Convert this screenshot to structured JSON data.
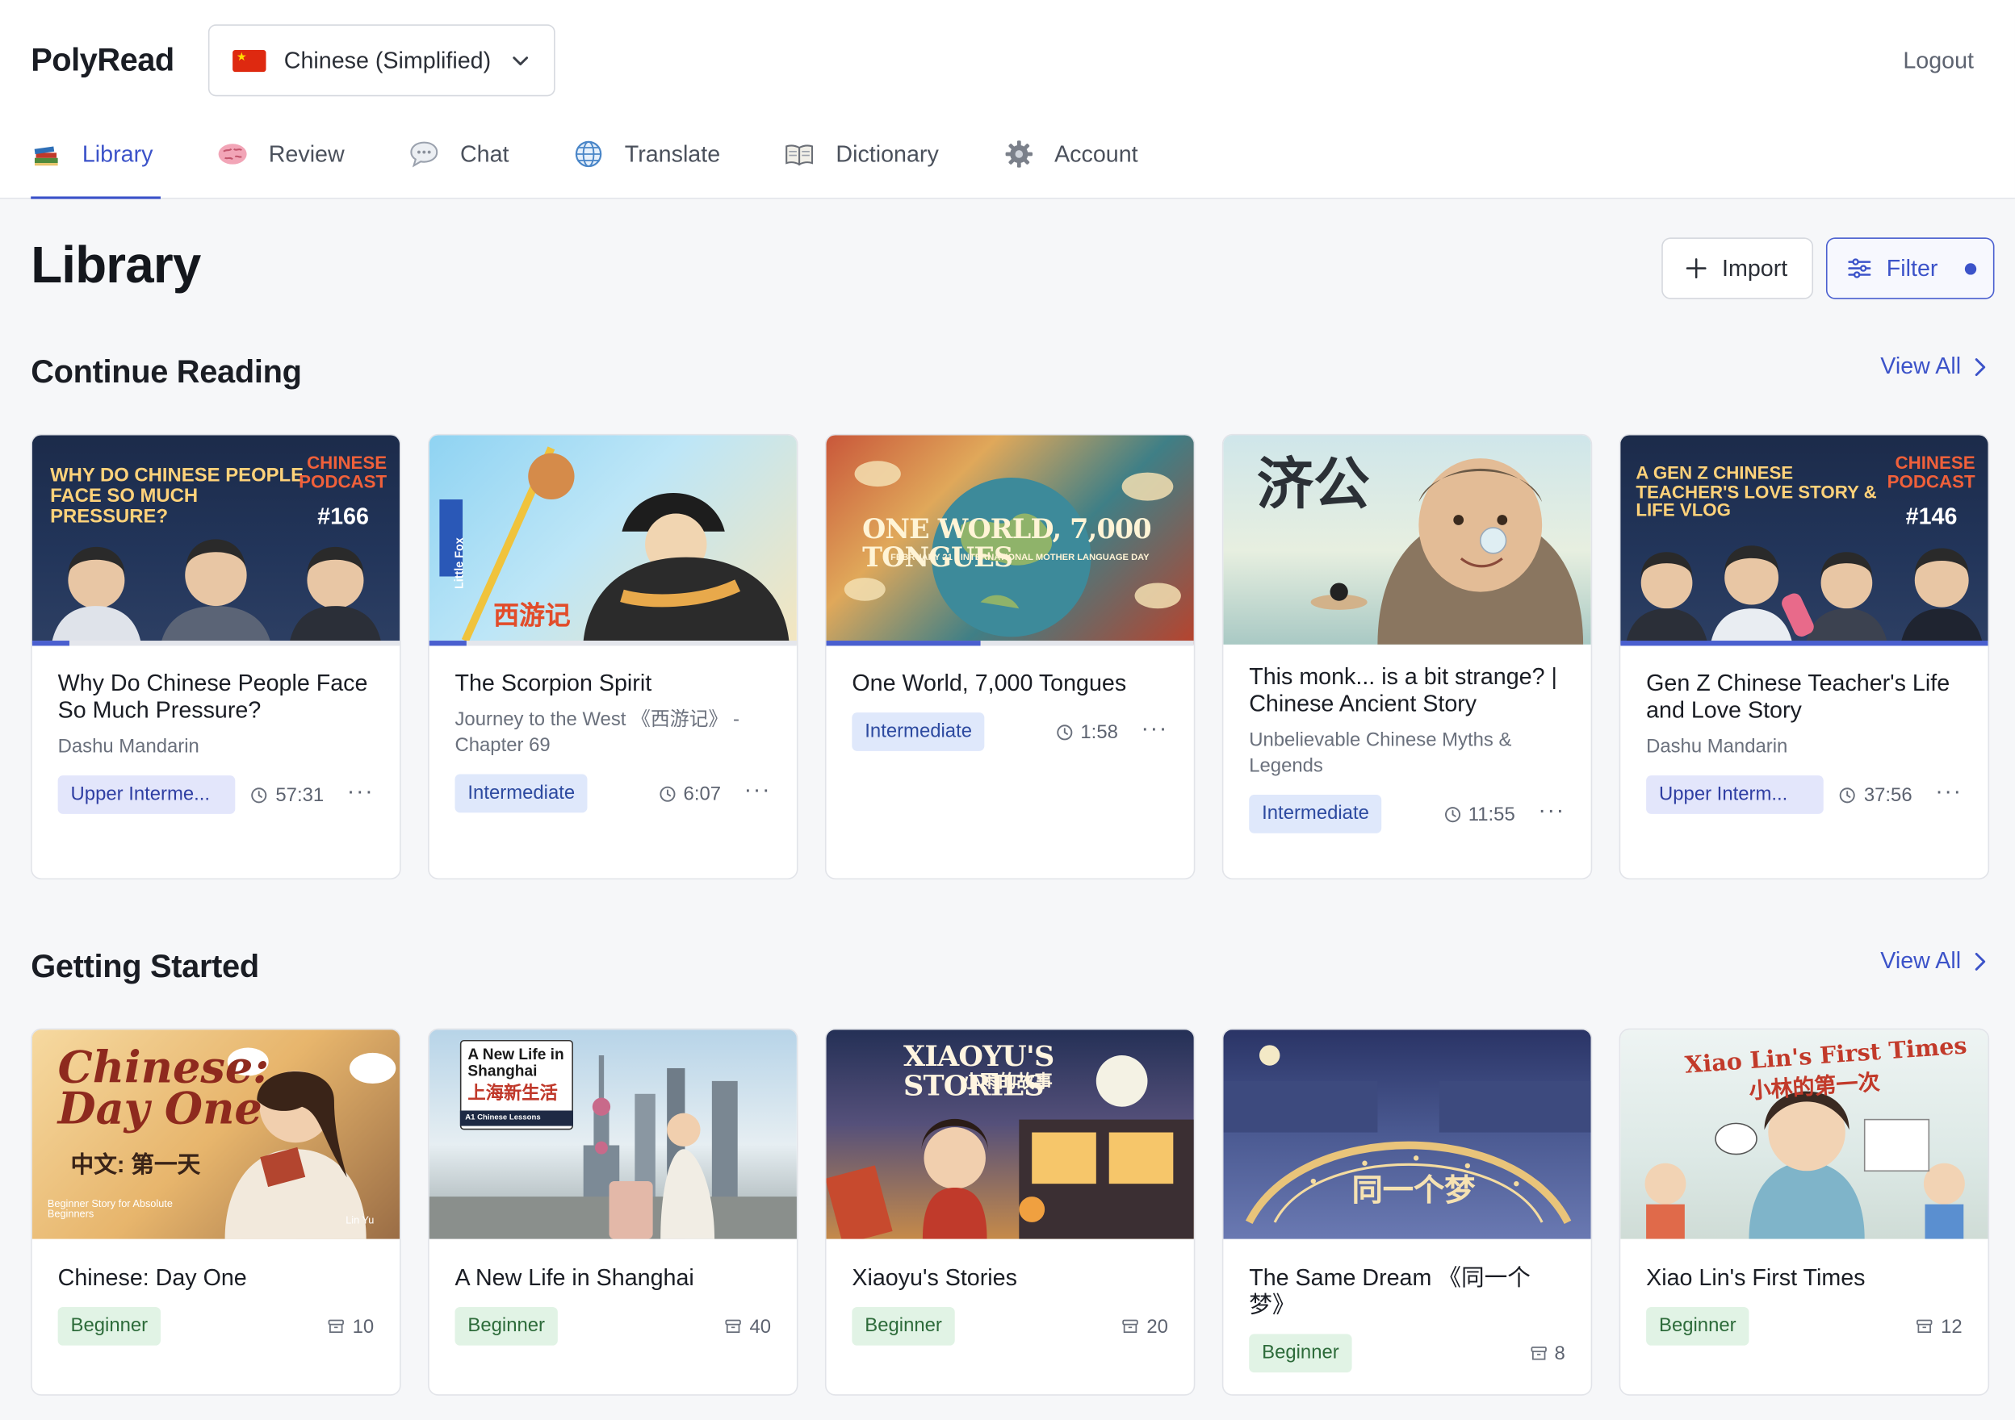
{
  "app": {
    "name": "PolyRead",
    "language": "Chinese (Simplified)",
    "logout_label": "Logout"
  },
  "nav": [
    {
      "label": "Library",
      "icon": "books-icon"
    },
    {
      "label": "Review",
      "icon": "brain-icon"
    },
    {
      "label": "Chat",
      "icon": "speech-bubble-icon"
    },
    {
      "label": "Translate",
      "icon": "globe-icon"
    },
    {
      "label": "Dictionary",
      "icon": "open-book-icon"
    },
    {
      "label": "Account",
      "icon": "gear-icon"
    }
  ],
  "page": {
    "title": "Library",
    "import_label": "Import",
    "filter_label": "Filter"
  },
  "continue_reading": {
    "title": "Continue Reading",
    "view_all": "View All",
    "items": [
      {
        "title": "Why Do Chinese People Face So Much Pressure?",
        "source": "Dashu Mandarin",
        "level": "Upper Interme...",
        "duration": "57:31",
        "progress": 0.1,
        "thumb_title": "Why do Chinese people face so much pressure?",
        "thumb_tag": "Chinese Podcast",
        "thumb_number": "#166"
      },
      {
        "title": "The Scorpion Spirit",
        "source": "Journey to the West 《西游记》 - Chapter 69",
        "level": "Intermediate",
        "duration": "6:07",
        "progress": 0.1,
        "thumb_title": "西游记",
        "thumb_side": "Little Fox"
      },
      {
        "title": "One World, 7,000 Tongues",
        "level": "Intermediate",
        "duration": "1:58",
        "progress": 0.42,
        "thumb_title": "One World, 7,000 Tongues",
        "thumb_sub": "February 21 · International Mother Language Day"
      },
      {
        "title": "This monk... is a bit strange? | Chinese Ancient Story",
        "source": "Unbelievable Chinese Myths & Legends",
        "level": "Intermediate",
        "duration": "11:55",
        "progress": 0.0,
        "thumb_title": "济公"
      },
      {
        "title": "Gen Z Chinese Teacher's Life and Love Story",
        "source": "Dashu Mandarin",
        "level": "Upper Interm...",
        "duration": "37:56",
        "progress": 1.0,
        "thumb_title": "A Gen Z Chinese teacher's love story & life vlog",
        "thumb_tag": "Chinese Podcast",
        "thumb_number": "#146"
      }
    ]
  },
  "getting_started": {
    "title": "Getting Started",
    "view_all": "View All",
    "items": [
      {
        "title": "Chinese: Day One",
        "level": "Beginner",
        "count": "10",
        "thumb_title": "Chinese: Day One",
        "thumb_sub": "中文: 第一天",
        "thumb_note": "Beginner Story for Absolute Beginners",
        "thumb_author": "Lin Yu"
      },
      {
        "title": "A New Life in Shanghai",
        "level": "Beginner",
        "count": "40",
        "thumb_title": "A New Life in Shanghai",
        "thumb_sub": "上海新生活",
        "thumb_note": "A1 Chinese Lessons"
      },
      {
        "title": "Xiaoyu's Stories",
        "level": "Beginner",
        "count": "20",
        "thumb_title": "Xiaoyu's Stories",
        "thumb_sub": "小雨的故事"
      },
      {
        "title": "The Same Dream 《同一个梦》",
        "level": "Beginner",
        "count": "8",
        "thumb_title": "同一个梦"
      },
      {
        "title": "Xiao Lin's First Times",
        "level": "Beginner",
        "count": "12",
        "thumb_title": "Xiao Lin's First Times",
        "thumb_sub": "小林的第一次"
      }
    ]
  },
  "colors": {
    "accent": "#3c53c9",
    "badge_upper": "#e3e6fb",
    "badge_intermediate": "#dfe8fb",
    "badge_beginner": "#e1f3e5"
  }
}
